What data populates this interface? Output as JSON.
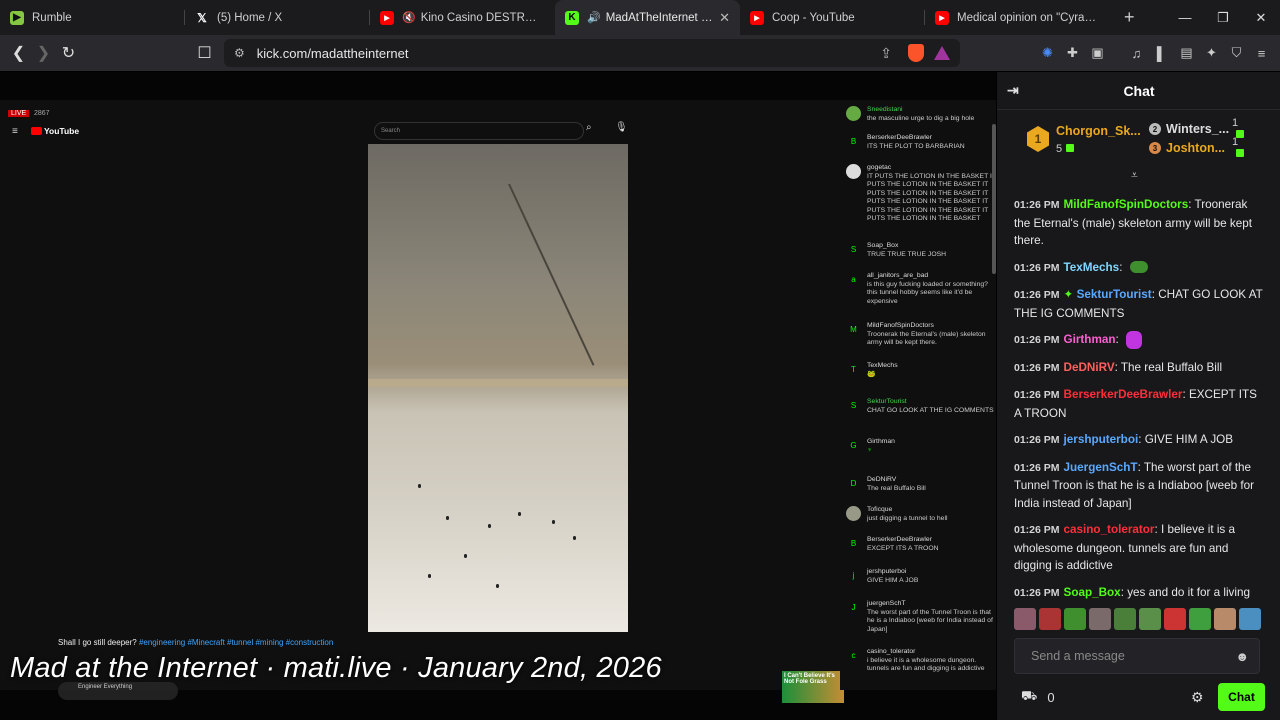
{
  "browser": {
    "tabs": [
      {
        "title": "Rumble",
        "icon": "rumble-icon",
        "color": "#85c742"
      },
      {
        "title": "(5) Home / X",
        "icon": "x-icon",
        "color": "#ffffff"
      },
      {
        "title": "Kino Casino DESTROYS DSP",
        "icon": "youtube-icon",
        "color": "#ff0000"
      },
      {
        "title": "MadAtTheInternet Stream",
        "icon": "kick-icon",
        "color": "#53fc18"
      },
      {
        "title": "Coop - YouTube",
        "icon": "youtube-icon",
        "color": "#ff0000"
      },
      {
        "title": "Medical opinion on \"Cyraxx\"s m",
        "icon": "youtube-icon",
        "color": "#ff0000"
      }
    ],
    "url": "kick.com/madattheinternet"
  },
  "video": {
    "live_label": "LIVE",
    "viewers": "2867",
    "yt_logo": "YouTube",
    "yt_search_placeholder": "Search",
    "caption_text": "Shall I go still deeper?",
    "caption_tags": "#engineering #Minecraft #tunnel #mining #construction",
    "engineer_badge": "Engineer Everything",
    "ad_text": "I Can't Believe It's Not Fole Grass",
    "watermark": "Mad at the Internet · mati.live · January 2nd, 2026",
    "yt_chat": [
      {
        "user": "Sneedistani",
        "text": "the masculine urge to dig a big hole",
        "green": true,
        "avatar": ""
      },
      {
        "user": "BerserkerDeeBrawler",
        "text": "ITS THE PLOT TO BARBARIAN",
        "green": false,
        "avatar": "B"
      },
      {
        "user": "gogetac",
        "text": "IT PUTS THE LOTION IN THE BASKET IT PUTS THE LOTION IN THE BASKET IT PUTS THE LOTION IN THE BASKET IT PUTS THE LOTION IN THE BASKET IT PUTS THE LOTION IN THE BASKET IT PUTS THE LOTION IN THE BASKET",
        "green": false,
        "avatar": ""
      },
      {
        "user": "Soap_Box",
        "text": "TRUE TRUE TRUE JOSH",
        "green": false,
        "avatar": "S"
      },
      {
        "user": "all_janitors_are_bad",
        "text": "is this guy fucking loaded or something? this tunnel hobby seems like it'd be expensive",
        "green": false,
        "avatar": "a"
      },
      {
        "user": "MildFanofSpinDoctors",
        "text": "Troonerak the Eternal's (male) skeleton army will be kept there.",
        "green": false,
        "avatar": "M"
      },
      {
        "user": "TexMechs",
        "text": "",
        "green": false,
        "avatar": "T"
      },
      {
        "user": "SekturTourist",
        "text": "CHAT GO LOOK AT THE IG COMMENTS",
        "green": true,
        "avatar": "S"
      },
      {
        "user": "Girthman",
        "text": "",
        "green": false,
        "avatar": "G"
      },
      {
        "user": "DeDNiRV",
        "text": "The real Buffalo Bill",
        "green": false,
        "avatar": "D"
      },
      {
        "user": "Toficque",
        "text": "just digging a tunnel to hell",
        "green": false,
        "avatar": ""
      },
      {
        "user": "BerserkerDeeBrawler",
        "text": "EXCEPT ITS A TROON",
        "green": false,
        "avatar": "B"
      },
      {
        "user": "jershputerboi",
        "text": "GIVE HIM A JOB",
        "green": false,
        "avatar": "j"
      },
      {
        "user": "juergenSchT",
        "text": "The worst part of the Tunnel Troon is that he is a Indiaboo [weeb for India instead of Japan]",
        "green": false,
        "avatar": "J"
      },
      {
        "user": "casino_tolerator",
        "text": "i believe it is a wholesome dungeon. tunnels are fun and digging is addictive",
        "green": false,
        "avatar": "c"
      }
    ]
  },
  "chat": {
    "title": "Chat",
    "top_gifter": {
      "rank": "1",
      "name": "Chorgon_Sk...",
      "count": "5"
    },
    "gifter2": {
      "rank": "2",
      "name": "Winters_...",
      "count": "1"
    },
    "gifter3": {
      "rank": "3",
      "name": "Joshton...",
      "count": "1"
    },
    "messages": [
      {
        "time": "01:26 PM",
        "user": "MildFanofSpinDoctors",
        "color": "#53fc18",
        "text": "Troonerak the Eternal's (male) skeleton army will be kept there.",
        "emote": ""
      },
      {
        "time": "01:26 PM",
        "user": "TexMechs",
        "color": "#7fd7ff",
        "text": "",
        "emote": "frog-emote"
      },
      {
        "time": "01:26 PM",
        "user": "SekturTourist",
        "color": "#5aa9ff",
        "text": "CHAT GO LOOK AT THE IG COMMENTS",
        "emote": ""
      },
      {
        "time": "01:26 PM",
        "user": "Girthman",
        "color": "#ff5fd2",
        "text": "",
        "emote": "butterfly-emote"
      },
      {
        "time": "01:26 PM",
        "user": "DeDNiRV",
        "color": "#ff5f5f",
        "text": "The real Buffalo Bill",
        "emote": ""
      },
      {
        "time": "01:26 PM",
        "user": "BerserkerDeeBrawler",
        "color": "#ff2e3a",
        "text": "EXCEPT ITS A TROON",
        "emote": ""
      },
      {
        "time": "01:26 PM",
        "user": "jershputerboi",
        "color": "#5aa9ff",
        "text": "GIVE HIM A JOB",
        "emote": ""
      },
      {
        "time": "01:26 PM",
        "user": "JuergenSchT",
        "color": "#5aa9ff",
        "text": "The worst part of the Tunnel Troon is that he is a Indiaboo [weeb for India instead of Japan]",
        "emote": ""
      },
      {
        "time": "01:26 PM",
        "user": "casino_tolerator",
        "color": "#ff2e3a",
        "text": "I believe it is a wholesome dungeon. tunnels are fun and digging is addictive",
        "emote": ""
      },
      {
        "time": "01:26 PM",
        "user": "Soap_Box",
        "color": "#53fc18",
        "text": "yes and do it for a living",
        "emote": ""
      }
    ],
    "send_placeholder": "Send a message",
    "kicks_count": "0",
    "chat_button": "Chat"
  }
}
